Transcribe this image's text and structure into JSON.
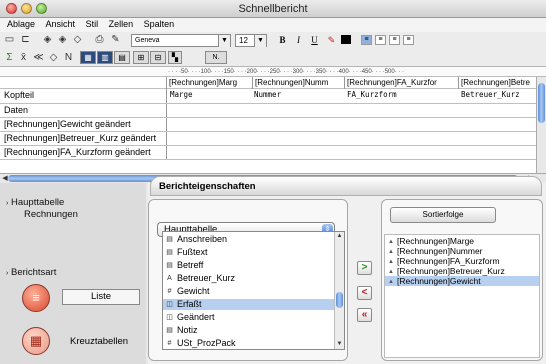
{
  "window": {
    "title": "Schnellbericht"
  },
  "menu": [
    "Ablage",
    "Ansicht",
    "Stil",
    "Zellen",
    "Spalten"
  ],
  "toolbar": {
    "font": "Geneva",
    "size": "12",
    "bold": "B",
    "italic": "I",
    "underline": "U",
    "style_sample": "N."
  },
  "ruler": "· · · ·50· · · ·100· · · ·150· · · ·200· · · ·250· · · ·300· · · ·350· · · ·400· · · ·450· · · ·500· · ·",
  "report": {
    "columns": [
      "[Rechnungen]Marg",
      "[Rechnungen]Numm",
      "[Rechnungen]FA_Kurzfor",
      "[Rechnungen]Betre"
    ],
    "rows": [
      {
        "label": "Kopfteil",
        "cells": [
          "Marge",
          "Nummer",
          "FA_Kurzform",
          "Betreuer_Kurz"
        ]
      },
      {
        "label": "Daten",
        "cells": []
      },
      {
        "label": "[Rechnungen]Gewicht geändert",
        "cells": []
      },
      {
        "label": "[Rechnungen]Betreuer_Kurz geändert",
        "cells": []
      },
      {
        "label": "[Rechnungen]FA_Kurzform geändert",
        "cells": []
      }
    ]
  },
  "sidebar": {
    "haupttabelle_label": "Haupttabelle",
    "haupttabelle_value": "Rechnungen",
    "berichtsart_label": "Berichtsart",
    "liste_label": "Liste",
    "kreuztabellen_label": "Kreuztabellen"
  },
  "panel": {
    "title": "Berichteigenschaften",
    "table_popup": "Haupttabelle",
    "fields": [
      {
        "icon": "text-field-icon",
        "glyph": "▤",
        "label": "Anschreiben"
      },
      {
        "icon": "text-field-icon",
        "glyph": "▤",
        "label": "Fußtext"
      },
      {
        "icon": "text-field-icon",
        "glyph": "▤",
        "label": "Betreff"
      },
      {
        "icon": "alpha-field-icon",
        "glyph": "A",
        "label": "Betreuer_Kurz"
      },
      {
        "icon": "number-field-icon",
        "glyph": "#",
        "label": "Gewicht"
      },
      {
        "icon": "date-field-icon",
        "glyph": "◫",
        "label": "Erfaßt"
      },
      {
        "icon": "date-field-icon",
        "glyph": "◫",
        "label": "Geändert"
      },
      {
        "icon": "text-field-icon",
        "glyph": "▤",
        "label": "Notiz"
      },
      {
        "icon": "number-field-icon",
        "glyph": "#",
        "label": "USt_ProzPack"
      }
    ],
    "selected_field": "Erfaßt",
    "sort_header": "Sortierfolge",
    "sort_items": [
      "[Rechnungen]Marge",
      "[Rechnungen]Nummer",
      "[Rechnungen]FA_Kurzform",
      "[Rechnungen]Betreuer_Kurz",
      "[Rechnungen]Gewicht"
    ],
    "selected_sort": "[Rechnungen]Gewicht",
    "buttons": {
      "add": ">",
      "remove": "<",
      "remove_all": "«"
    }
  }
}
